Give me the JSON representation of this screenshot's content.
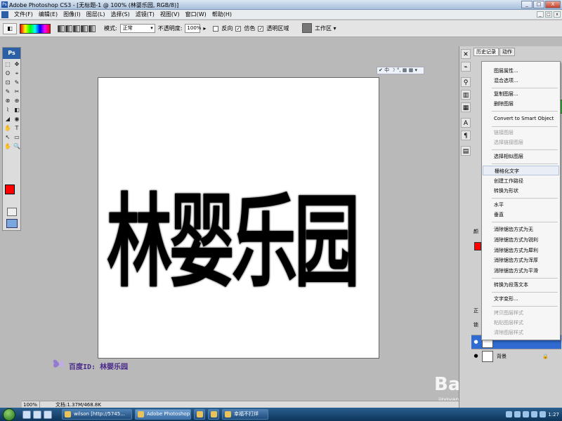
{
  "window": {
    "title": "Adobe Photoshop CS3 - [无标题-1 @ 100% (林婴乐园, RGB/8)]",
    "app_icon": "Ps",
    "min_label": "_",
    "max_label": "□",
    "close_label": "X"
  },
  "menubar": {
    "items": [
      "文件(F)",
      "编辑(E)",
      "图像(I)",
      "图层(L)",
      "选择(S)",
      "滤镜(T)",
      "视图(V)",
      "窗口(W)",
      "帮助(H)"
    ],
    "right_controls": [
      "_",
      "□",
      "x"
    ]
  },
  "options_bar": {
    "mode_label": "模式:",
    "mode_value": "正常",
    "opacity_label": "不透明度:",
    "opacity_value": "100%",
    "reverse_label": "反向",
    "dither_label": "仿色",
    "transparency_label": "透明区域",
    "dither_checked": "✓",
    "transparency_checked": "✓",
    "workspace_label": "工作区 ▾"
  },
  "toolbox": {
    "logo": "Ps",
    "tools": [
      "⬚",
      "✥",
      "ʘ",
      "⌖",
      "⊡",
      "✎",
      "✎",
      "✂",
      "⊗",
      "⊕",
      "⌇",
      "◧",
      "◢",
      "◉",
      "✋",
      "T",
      "↖",
      "▭",
      "✋",
      "🔍"
    ],
    "foreground_color": "#ff0000",
    "background_color": "#ffffff"
  },
  "canvas": {
    "text": "林婴乐园"
  },
  "ime_bar": {
    "text": "✔ 中 ☽ °, ▦ ▦ ▾"
  },
  "watermark": {
    "text": "百度ID: 林婴乐园",
    "baidu": "Baidu 经验",
    "baidu_sub": "jingyan.baidu.com"
  },
  "statusbar": {
    "zoom": "100%",
    "doc_info": "文档:1.37M/468.8K"
  },
  "panels": {
    "history_tab": "历史记录",
    "actions_tab": "动作",
    "lower_labels": [
      "颜",
      "正",
      "锁"
    ],
    "layers": [
      {
        "name": "",
        "selected": true
      },
      {
        "name": "背景",
        "selected": false
      }
    ]
  },
  "context_menu": {
    "items": [
      {
        "label": "图层属性...",
        "disabled": false
      },
      {
        "label": "混合选项...",
        "disabled": false
      },
      {
        "label": "复制图层...",
        "disabled": false
      },
      {
        "label": "删除图层",
        "disabled": false
      },
      {
        "label": "Convert to Smart Object",
        "disabled": false
      },
      {
        "label": "链接图层",
        "disabled": true
      },
      {
        "label": "选择链接图层",
        "disabled": true
      },
      {
        "label": "选择相似图层",
        "disabled": false
      },
      {
        "label": "栅格化文字",
        "disabled": false,
        "hover": true
      },
      {
        "label": "创建工作路径",
        "disabled": false
      },
      {
        "label": "转换为形状",
        "disabled": false
      },
      {
        "label": "水平",
        "disabled": false
      },
      {
        "label": "垂直",
        "disabled": false
      },
      {
        "label": "消除锯齿方式为无",
        "disabled": false
      },
      {
        "label": "消除锯齿方式为锐利",
        "disabled": false
      },
      {
        "label": "消除锯齿方式为犀利",
        "disabled": false
      },
      {
        "label": "消除锯齿方式为浑厚",
        "disabled": false
      },
      {
        "label": "消除锯齿方式为平滑",
        "disabled": false
      },
      {
        "label": "转换为段落文本",
        "disabled": false
      },
      {
        "label": "文字变形...",
        "disabled": false
      },
      {
        "label": "拷贝图层样式",
        "disabled": true
      },
      {
        "label": "粘贴图层样式",
        "disabled": true
      },
      {
        "label": "清除图层样式",
        "disabled": true
      }
    ]
  },
  "taskbar": {
    "tasks": [
      "wilson [http://5745...",
      "Adobe Photoshop ...",
      "幸福不打烊"
    ],
    "clock": "1:27"
  }
}
